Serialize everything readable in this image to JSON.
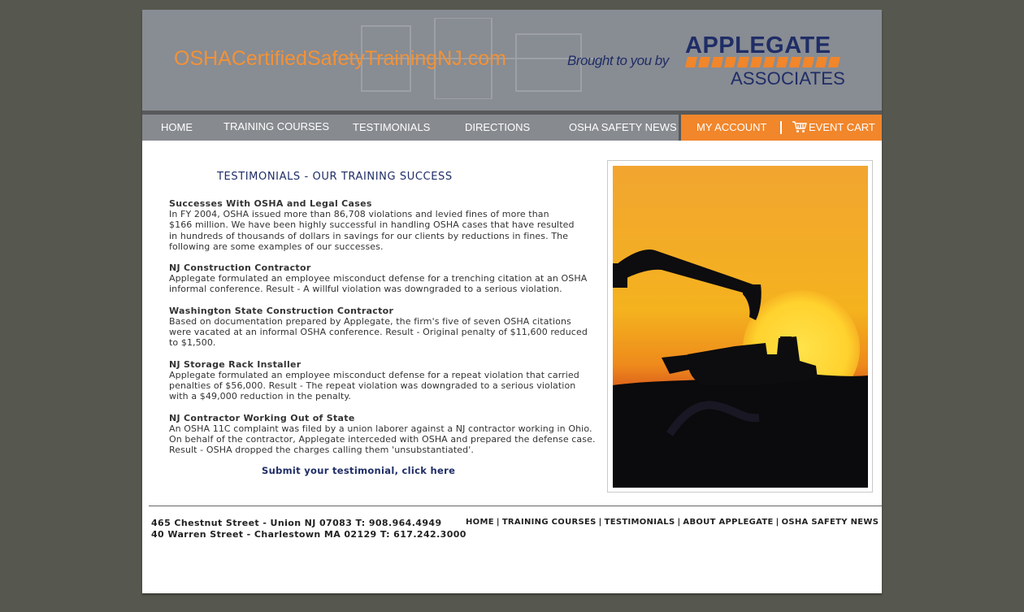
{
  "header": {
    "site_title": "OSHACertifiedSafetyTrainingNJ.com",
    "tagline": "Brought to you by",
    "logo_top": "APPLEGATE",
    "logo_bottom": "ASSOCIATES"
  },
  "nav": {
    "items": [
      "HOME",
      "TRAINING COURSES",
      "TESTIMONIALS",
      "DIRECTIONS",
      "OSHA SAFETY NEWS"
    ],
    "account": "MY ACCOUNT",
    "cart": "EVENT CART"
  },
  "main": {
    "heading": "TESTIMONIALS - OUR TRAINING SUCCESS",
    "cases": [
      {
        "title": "Successes With OSHA and Legal Cases",
        "lines": [
          "In FY 2004, OSHA issued more than 86,708 violations and levied fines of more than",
          "$166 million. We have been highly successful in handling OSHA cases that have resulted",
          "in hundreds of thousands of dollars in savings for our clients by reductions in fines. The",
          "following are some examples of our successes."
        ]
      },
      {
        "title": "NJ Construction Contractor",
        "lines": [
          "Applegate formulated an employee misconduct defense for a trenching citation at an OSHA",
          "informal conference. Result - A willful violation was downgraded to a serious violation."
        ]
      },
      {
        "title": "Washington State Construction Contractor",
        "lines": [
          "Based on documentation prepared by Applegate, the firm's five of seven OSHA citations",
          "were vacated at an informal OSHA conference. Result - Original penalty of $11,600 reduced",
          "to $1,500."
        ]
      },
      {
        "title": "NJ Storage Rack Installer",
        "lines": [
          "Applegate formulated an employee misconduct defense for a repeat violation that carried",
          "penalties of $56,000. Result - The repeat violation was downgraded to a serious violation",
          "with a $49,000 reduction in the penalty."
        ]
      },
      {
        "title": "NJ Contractor Working Out of State",
        "lines": [
          "An OSHA 11C complaint was filed by a union laborer against a NJ contractor working in Ohio.",
          "On behalf of the contractor, Applegate interceded with OSHA and prepared the defense case.",
          "Result - OSHA dropped the charges calling them 'unsubstantiated'."
        ]
      }
    ],
    "submit_link": "Submit your testimonial, click here"
  },
  "footer": {
    "address_lines": [
      "465 Chestnut Street - Union NJ 07083 T: 908.964.4949",
      "40 Warren Street - Charlestown MA 02129 T: 617.242.3000"
    ],
    "links": [
      "HOME",
      "TRAINING COURSES",
      "TESTIMONIALS",
      "ABOUT APPLEGATE",
      "OSHA SAFETY NEWS"
    ]
  },
  "colors": {
    "background": "#56574e",
    "header": "#888c93",
    "accent_orange": "#f1862b",
    "brand_navy": "#1f2d66"
  }
}
